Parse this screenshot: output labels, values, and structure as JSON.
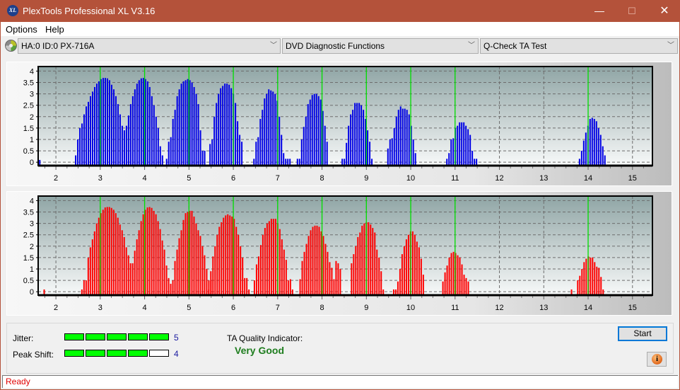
{
  "window": {
    "title": "PlexTools Professional XL V3.16",
    "app_icon": "XL",
    "minimize": "—",
    "maximize": "☐",
    "close": "✕"
  },
  "menu": [
    "Options",
    "Help"
  ],
  "toolbar": {
    "device": "HA:0 ID:0  PX-716A",
    "function": "DVD Diagnostic Functions",
    "test": "Q-Check TA Test"
  },
  "results": {
    "jitter_label": "Jitter:",
    "jitter_value": "5",
    "jitter_level": 5,
    "peak_shift_label": "Peak Shift:",
    "peak_shift_value": "4",
    "peak_shift_level": 4,
    "meter_max": 5,
    "ta_label": "TA Quality Indicator:",
    "ta_value": "Very Good",
    "start_label": "Start",
    "info_glyph": "i"
  },
  "status": "Ready",
  "colors": {
    "top_bars": "#0000e6",
    "bottom_bars": "#ff0000",
    "marker": "#00e000",
    "quality": "#1e7d1e",
    "status": "#e00000"
  },
  "chart_data": [
    {
      "type": "bar",
      "name": "ta-top-land",
      "title": "",
      "xlim": [
        1.6,
        15.45
      ],
      "ylim": [
        -0.15,
        4.2
      ],
      "xticks": [
        2,
        3,
        4,
        5,
        6,
        7,
        8,
        9,
        10,
        11,
        12,
        13,
        14,
        15
      ],
      "yticks": [
        "0",
        "0.5",
        "1",
        "1.5",
        "2",
        "2.5",
        "3",
        "3.5",
        "4"
      ],
      "markers": [
        3,
        4,
        5,
        6,
        7,
        8,
        9,
        10,
        11,
        14
      ],
      "step": 0.0477,
      "clusters": [
        {
          "start": 1.62,
          "values": [
            0.1
          ]
        },
        {
          "start": 2.43,
          "values": [
            0.3,
            1.0,
            1.5,
            1.7,
            2.1,
            2.45,
            2.65,
            2.9,
            3.1,
            3.3,
            3.45,
            3.55,
            3.65,
            3.7,
            3.7,
            3.68,
            3.6,
            3.4,
            3.2,
            2.9,
            2.55,
            2.1,
            1.6,
            1.4,
            1.6,
            2.05,
            2.55,
            2.9,
            3.2,
            3.45,
            3.6,
            3.68,
            3.7,
            3.65,
            3.55,
            3.3,
            2.9,
            2.5,
            2.0,
            1.5,
            0.7,
            0.3
          ]
        },
        {
          "start": 4.48,
          "values": [
            0.15,
            0.9,
            1.1,
            1.9,
            2.3,
            2.9,
            3.2,
            3.45,
            3.55,
            3.6,
            3.65,
            3.6,
            3.5,
            3.3,
            3.0,
            2.55,
            1.4,
            0.5,
            0.5
          ]
        },
        {
          "start": 5.46,
          "values": [
            0.8,
            1.0,
            2.0,
            2.6,
            3.0,
            3.25,
            3.35,
            3.45,
            3.45,
            3.4,
            3.25,
            3.0,
            2.6,
            1.8,
            1.2,
            0.9
          ]
        },
        {
          "start": 6.45,
          "values": [
            0.15,
            0.9,
            1.1,
            1.9,
            2.3,
            2.8,
            3.0,
            3.2,
            3.15,
            3.1,
            3.0,
            2.7,
            2.0,
            1.2,
            0.4,
            0.15,
            0.15,
            0.15
          ]
        },
        {
          "start": 7.43,
          "values": [
            0.15,
            0.15,
            1.0,
            1.55,
            2.0,
            2.55,
            2.75,
            2.95,
            3.0,
            3.0,
            2.9,
            2.75,
            2.25,
            1.6,
            0.9
          ]
        },
        {
          "start": 8.44,
          "values": [
            0.15,
            0.15,
            0.85,
            1.6,
            2.1,
            2.3,
            2.6,
            2.6,
            2.6,
            2.5,
            2.3,
            1.9,
            1.4,
            0.9,
            0.15
          ]
        },
        {
          "start": 9.47,
          "values": [
            0.6,
            1.0,
            1.05,
            1.5,
            2.0,
            2.3,
            2.45,
            2.35,
            2.35,
            2.3,
            2.1,
            1.6,
            1.0,
            0.4
          ]
        },
        {
          "start": 10.8,
          "values": [
            0.15,
            0.4,
            1.0,
            1.05,
            1.5,
            1.6,
            1.75,
            1.75,
            1.75,
            1.6,
            1.45,
            1.2,
            0.5,
            0.15,
            0.15
          ]
        },
        {
          "start": 13.79,
          "values": [
            0.15,
            0.5,
            0.95,
            1.3,
            1.6,
            1.9,
            1.95,
            1.9,
            1.8,
            1.5,
            1.2,
            0.7,
            0.3
          ]
        }
      ]
    },
    {
      "type": "bar",
      "name": "ta-bottom-pit",
      "title": "",
      "xlim": [
        1.6,
        15.45
      ],
      "ylim": [
        -0.15,
        4.2
      ],
      "xticks": [
        2,
        3,
        4,
        5,
        6,
        7,
        8,
        9,
        10,
        11,
        12,
        13,
        14,
        15
      ],
      "yticks": [
        "0",
        "0.5",
        "1",
        "1.5",
        "2",
        "2.5",
        "3",
        "3.5",
        "4"
      ],
      "markers": [
        3,
        4,
        5,
        6,
        7,
        8,
        9,
        10,
        11,
        14
      ],
      "step": 0.0477,
      "clusters": [
        {
          "start": 1.72,
          "values": [
            0.1
          ]
        },
        {
          "start": 2.57,
          "values": [
            0.1,
            0.5,
            0.5,
            1.5,
            1.95,
            2.3,
            2.65,
            3.0,
            3.25,
            3.45,
            3.6,
            3.7,
            3.72,
            3.72,
            3.68,
            3.6,
            3.45,
            3.25,
            2.95,
            2.7,
            2.4,
            1.95,
            1.6,
            1.25,
            1.25,
            1.8,
            2.3,
            2.7,
            3.1,
            3.4,
            3.6,
            3.7,
            3.72,
            3.68,
            3.55,
            3.4,
            3.1,
            2.75,
            2.25,
            1.85,
            1.15,
            0.6,
            0.35,
            0.5,
            1.35,
            1.85,
            2.35,
            2.7,
            3.15,
            3.45,
            3.5,
            3.55,
            3.55,
            3.3,
            3.0,
            2.7,
            2.45,
            2.0,
            1.6,
            1.0,
            0.5,
            0.5
          ]
        },
        {
          "start": 5.43,
          "values": [
            0.1,
            0.9,
            1.55,
            2.0,
            2.5,
            2.85,
            3.05,
            3.25,
            3.35,
            3.4,
            3.35,
            3.3,
            3.2,
            2.85,
            2.5,
            2.0,
            1.5,
            0.6,
            0.6,
            0.1
          ]
        },
        {
          "start": 6.46,
          "values": [
            0.5,
            1.2,
            1.55,
            2.05,
            2.5,
            2.8,
            3.0,
            3.1,
            3.2,
            3.2,
            3.2,
            3.0,
            2.75,
            2.3,
            1.85,
            1.4,
            0.5,
            0.55,
            0.1
          ]
        },
        {
          "start": 7.49,
          "values": [
            0.55,
            1.35,
            1.75,
            2.1,
            2.45,
            2.7,
            2.85,
            2.9,
            2.9,
            2.85,
            2.65,
            2.45,
            2.1,
            1.75,
            1.3,
            1.05,
            0.55,
            1.35,
            1.25,
            1.0
          ]
        },
        {
          "start": 8.65,
          "values": [
            1.25,
            1.65,
            2.0,
            2.4,
            2.6,
            2.9,
            3.0,
            3.05,
            3.05,
            2.95,
            2.8,
            2.6,
            1.85,
            1.5,
            0.9,
            0.1
          ]
        },
        {
          "start": 9.6,
          "values": [
            0.1,
            0.1,
            0.45,
            1.0,
            1.65,
            2.0,
            2.3,
            2.5,
            2.65,
            2.65,
            2.5,
            2.2,
            1.95,
            1.45,
            0.75
          ]
        },
        {
          "start": 10.71,
          "values": [
            0.45,
            0.85,
            1.15,
            1.5,
            1.7,
            1.75,
            1.7,
            1.6,
            1.5,
            1.2,
            0.75,
            0.6,
            0.45
          ]
        },
        {
          "start": 13.61,
          "values": [
            0.1
          ]
        },
        {
          "start": 13.75,
          "values": [
            0.5,
            0.7,
            1.0,
            1.3,
            1.45,
            1.55,
            1.5,
            1.5,
            1.3,
            1.1,
            1.05,
            0.65,
            0.1
          ]
        }
      ]
    }
  ]
}
